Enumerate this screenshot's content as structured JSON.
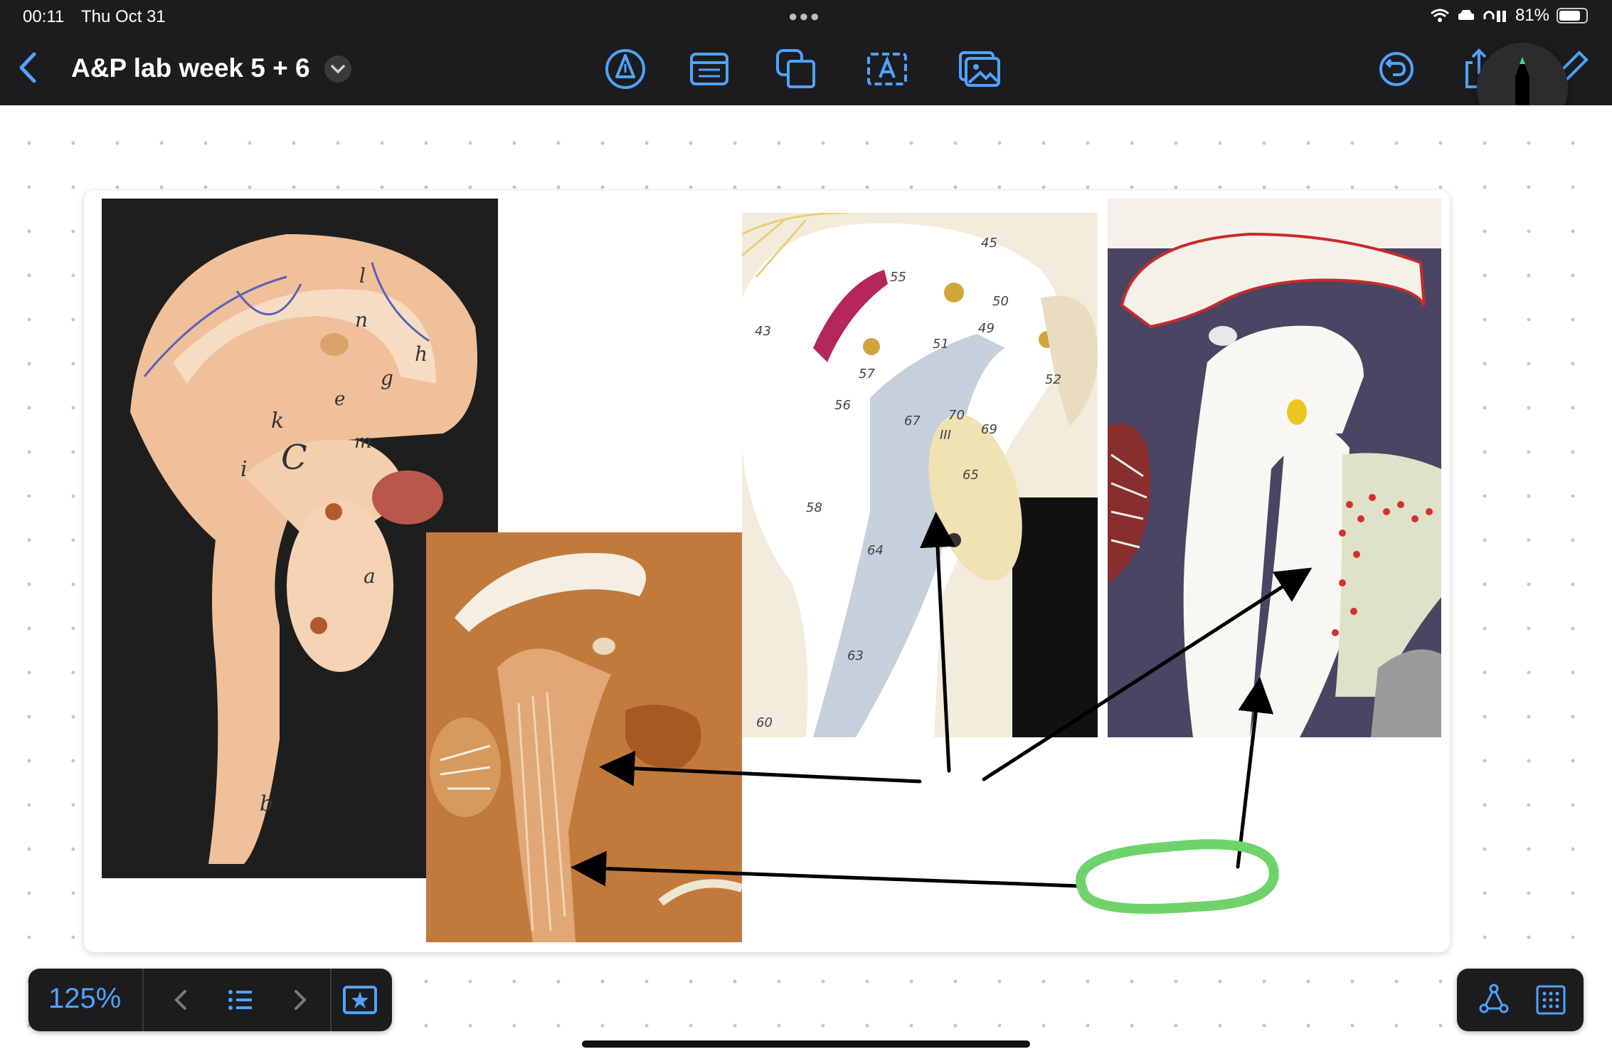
{
  "status_bar": {
    "time": "00:11",
    "date": "Thu Oct 31",
    "battery": "81%",
    "battery_level": 0.81
  },
  "toolbar": {
    "title": "A&P lab week 5 + 6",
    "tools": [
      "pen-icon",
      "text-box-icon",
      "shapes-icon",
      "text-icon",
      "image-icon"
    ],
    "right_tools": [
      "undo-icon",
      "share-icon",
      "compose-icon"
    ]
  },
  "canvas": {
    "zoom": "125%",
    "model1_labels": [
      "l",
      "n",
      "h",
      "g",
      "e",
      "k",
      "m",
      "C",
      "i",
      "a",
      "b"
    ],
    "model3_labels": [
      "45",
      "55",
      "50",
      "43",
      "49",
      "51",
      "57",
      "56",
      "67",
      "70",
      "52",
      "69",
      "III",
      "65",
      "64",
      "58",
      "63",
      "60"
    ]
  },
  "colors": {
    "accent": "#4fa3ff",
    "toolbar_bg": "#1c1c1e",
    "highlight": "#6ed36b",
    "pen_tip": "#3ddc84"
  }
}
